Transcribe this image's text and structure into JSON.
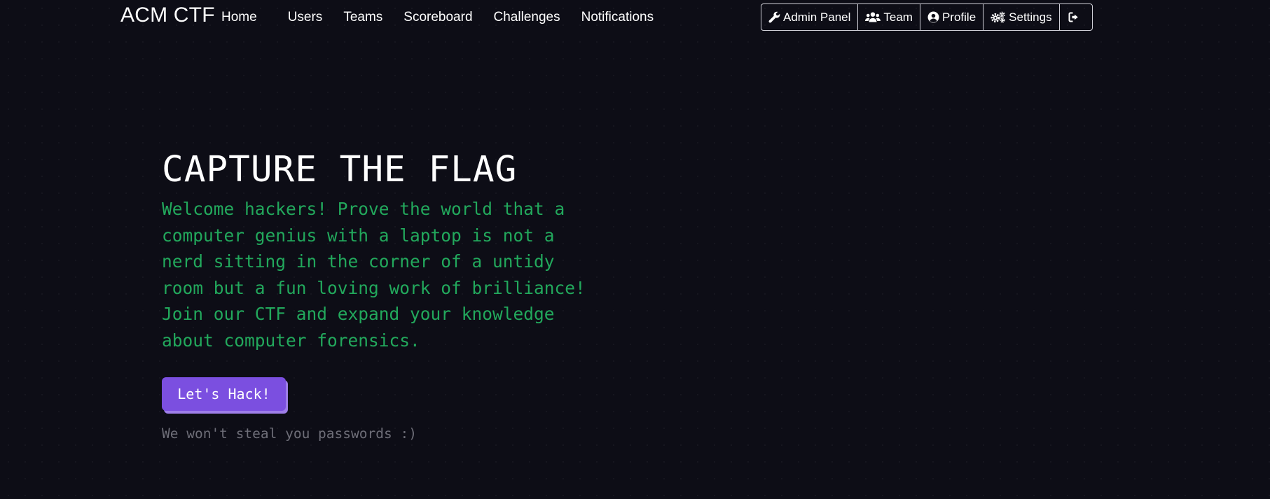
{
  "navbar": {
    "brand": "ACM CTF",
    "links": [
      {
        "label": "Home"
      },
      {
        "label": "Users"
      },
      {
        "label": "Teams"
      },
      {
        "label": "Scoreboard"
      },
      {
        "label": "Challenges"
      },
      {
        "label": "Notifications"
      }
    ],
    "actions": [
      {
        "label": "Admin Panel",
        "icon": "wrench-icon"
      },
      {
        "label": "Team",
        "icon": "users-icon"
      },
      {
        "label": "Profile",
        "icon": "user-circle-icon"
      },
      {
        "label": "Settings",
        "icon": "cogs-icon"
      },
      {
        "label": "",
        "icon": "sign-out-icon"
      }
    ]
  },
  "hero": {
    "title": "CAPTURE THE FLAG",
    "text": "Welcome hackers! Prove the world that a computer genius with a laptop is not a nerd sitting in the corner of a untidy room but a fun loving work of brilliance! Join our CTF and expand your knowledge about computer forensics.",
    "button_label": "Let's Hack!",
    "note": "We won't steal you passwords :)"
  },
  "colors": {
    "background": "#0d0d16",
    "accent_green": "#22a85c",
    "button_purple": "#7b4fe0",
    "muted_text": "#6e6e78"
  }
}
